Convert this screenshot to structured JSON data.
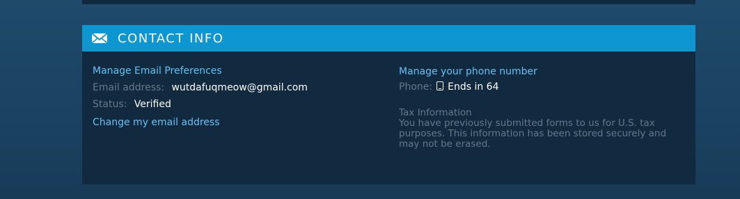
{
  "section": {
    "title": "CONTACT INFO",
    "icon": "envelope-icon",
    "header_color": "#0d96d0"
  },
  "email": {
    "manage_prefs_link": "Manage Email Preferences",
    "address_label": "Email address:",
    "address_value": "wutdafuqmeow@gmail.com",
    "status_label": "Status:",
    "status_value": "Verified",
    "change_link": "Change my email address"
  },
  "phone": {
    "manage_link": "Manage your phone number",
    "label": "Phone:",
    "icon": "mobile-phone-icon",
    "value": "Ends in 64"
  },
  "tax": {
    "title": "Tax Information",
    "text": "You have previously submitted forms to us for U.S. tax purposes. This information has been stored securely and may not be erased."
  }
}
